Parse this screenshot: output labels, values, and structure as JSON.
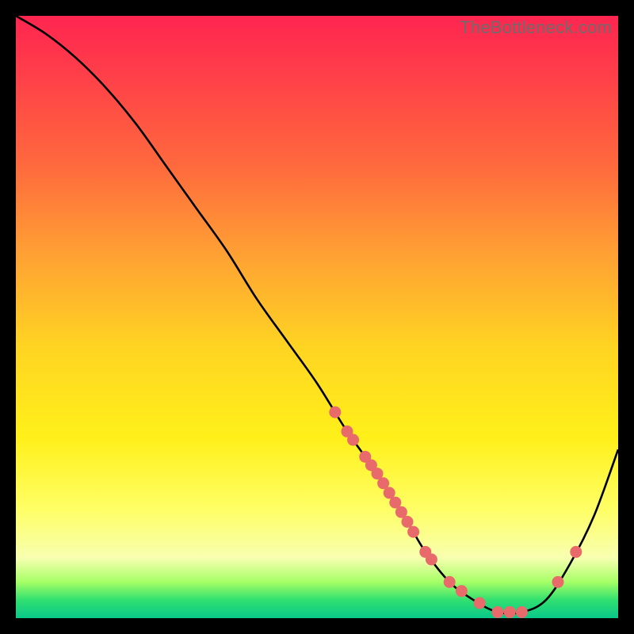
{
  "watermark": "TheBottleneck.com",
  "chart_data": {
    "type": "line",
    "title": "",
    "xlabel": "",
    "ylabel": "",
    "xlim": [
      0,
      100
    ],
    "ylim": [
      0,
      100
    ],
    "grid": false,
    "legend": false,
    "series": [
      {
        "name": "curve",
        "x": [
          0,
          5,
          10,
          15,
          20,
          25,
          30,
          35,
          40,
          45,
          50,
          55,
          60,
          65,
          68,
          72,
          76,
          80,
          84,
          88,
          92,
          96,
          100
        ],
        "y": [
          100,
          97,
          93,
          88,
          82,
          75,
          68,
          61,
          53,
          46,
          39,
          31,
          24,
          16,
          11,
          6,
          3,
          1,
          1,
          3,
          9,
          17,
          28
        ]
      }
    ],
    "points_on_curve_x": [
      53,
      55,
      56,
      58,
      59,
      60,
      61,
      62,
      63,
      64,
      65,
      66,
      68,
      69,
      72,
      74,
      77,
      80,
      82,
      84,
      90,
      93
    ],
    "dot_color": "#e96a6a",
    "gradient_stops": [
      {
        "pos": 0,
        "color": "#ff2550"
      },
      {
        "pos": 25,
        "color": "#ff6a3d"
      },
      {
        "pos": 55,
        "color": "#ffd422"
      },
      {
        "pos": 82,
        "color": "#ffff66"
      },
      {
        "pos": 97,
        "color": "#30e070"
      },
      {
        "pos": 100,
        "color": "#09c78a"
      }
    ]
  }
}
